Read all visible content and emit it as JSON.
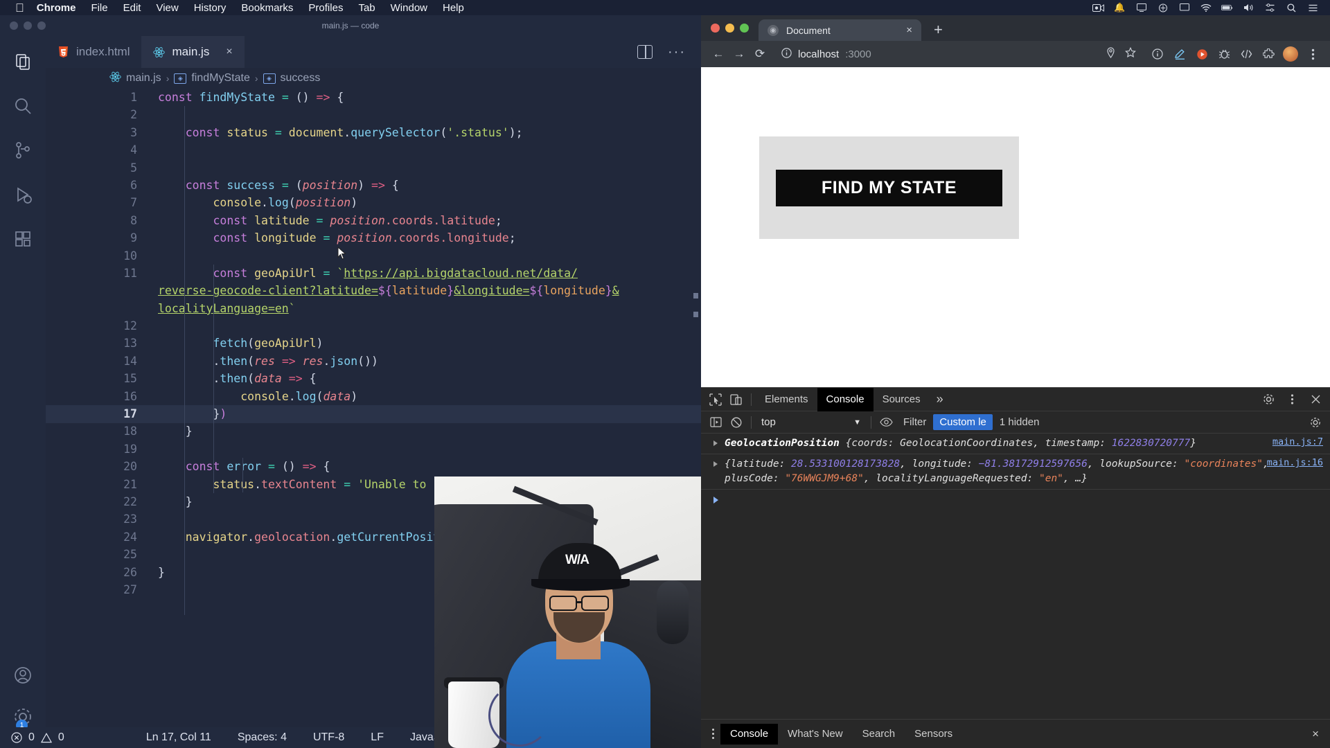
{
  "menubar": {
    "apple": "",
    "items": [
      {
        "label": "Chrome",
        "bold": true
      },
      {
        "label": "File"
      },
      {
        "label": "Edit"
      },
      {
        "label": "View"
      },
      {
        "label": "History"
      },
      {
        "label": "Bookmarks"
      },
      {
        "label": "Profiles"
      },
      {
        "label": "Tab"
      },
      {
        "label": "Window"
      },
      {
        "label": "Help"
      }
    ],
    "status_icons": [
      "video-camera-icon",
      "bell-icon",
      "screen-share-icon",
      "shield-icon",
      "display-icon",
      "wifi-icon",
      "battery-icon",
      "volume-icon",
      "control-center-icon",
      "search-icon",
      "list-icon"
    ]
  },
  "vscode": {
    "window_title": "main.js — code",
    "tabs": [
      {
        "label": "index.html",
        "icon": "html5-icon",
        "active": false
      },
      {
        "label": "main.js",
        "icon": "react-icon",
        "active": true
      }
    ],
    "tab_close_label": "×",
    "toolbar": {
      "split_editor": "split-editor-icon",
      "more_actions": "···"
    },
    "breadcrumb": {
      "file_icon": "react-icon",
      "parts": [
        "main.js",
        "findMyState",
        "success"
      ],
      "separator": "›"
    },
    "activity_items": [
      "explorer-icon",
      "search-icon",
      "source-control-icon",
      "run-debug-icon",
      "extensions-icon"
    ],
    "activity_bottom": [
      "accounts-icon",
      "settings-gear-icon"
    ],
    "settings_badge": "1",
    "statusbar": {
      "errors": "0",
      "warnings": "0",
      "position": "Ln 17, Col 11",
      "indent": "Spaces: 4",
      "encoding": "UTF-8",
      "eol": "LF",
      "language": "JavaScript React"
    },
    "current_line": 17,
    "code_lines": [
      {
        "n": "1",
        "html": "<span class='k'>const</span> <span class='fn'>findMyState</span> <span class='op'>=</span> <span class='par'>(</span><span class='par'>)</span> <span class='arrow'>=&gt;</span> <span class='par'>{</span>"
      },
      {
        "n": "2",
        "html": ""
      },
      {
        "n": "3",
        "html": "    <span class='k'>const</span> <span class='id'>status</span> <span class='op'>=</span> <span class='id'>document</span><span class='plain'>.</span><span class='fn'>querySelector</span><span class='par'>(</span><span class='str'>'.status'</span><span class='par'>)</span><span class='plain'>;</span>"
      },
      {
        "n": "4",
        "html": ""
      },
      {
        "n": "5",
        "html": ""
      },
      {
        "n": "6",
        "html": "    <span class='k'>const</span> <span class='fn'>success</span> <span class='op'>=</span> <span class='par'>(</span><span class='it'>position</span><span class='par'>)</span> <span class='arrow'>=&gt;</span> <span class='par'>{</span>"
      },
      {
        "n": "7",
        "html": "        <span class='id'>console</span><span class='plain'>.</span><span class='fn'>log</span><span class='par'>(</span><span class='it'>position</span><span class='par'>)</span>"
      },
      {
        "n": "8",
        "html": "        <span class='k'>const</span> <span class='id'>latitude</span> <span class='op'>=</span> <span class='it'>position</span><span class='prop'>.coords</span><span class='prop'>.latitude</span><span class='plain'>;</span>"
      },
      {
        "n": "9",
        "html": "        <span class='k'>const</span> <span class='id'>longitude</span> <span class='op'>=</span> <span class='it'>position</span><span class='prop'>.coords</span><span class='prop'>.longitude</span><span class='plain'>;</span>"
      },
      {
        "n": "10",
        "html": ""
      },
      {
        "n": "11",
        "html": "        <span class='k'>const</span> <span class='id'>geoApiUrl</span> <span class='op'>=</span> <span class='str'>`</span><span class='tpl'>https://api.bigdatacloud.net/data/</span>"
      },
      {
        "n": "",
        "html": "<span class='tpl'>reverse-geocode-client?latitude=</span><span class='dlr'>${</span><span class='ivar'>latitude</span><span class='dlr'>}</span><span class='tpl'>&amp;longitude=</span><span class='dlr'>${</span><span class='ivar'>longitude</span><span class='dlr'>}</span><span class='tpl'>&amp;</span>"
      },
      {
        "n": "",
        "html": "<span class='tpl'>localityLanguage=en</span><span class='str'>`</span>"
      },
      {
        "n": "12",
        "html": ""
      },
      {
        "n": "13",
        "html": "        <span class='fn'>fetch</span><span class='par'>(</span><span class='id'>geoApiUrl</span><span class='par'>)</span>"
      },
      {
        "n": "14",
        "html": "        <span class='plain'>.</span><span class='fn'>then</span><span class='par'>(</span><span class='it'>res</span> <span class='arrow'>=&gt;</span> <span class='it'>res</span><span class='plain'>.</span><span class='fn'>json</span><span class='par'>()</span><span class='par'>)</span>"
      },
      {
        "n": "15",
        "html": "        <span class='plain'>.</span><span class='fn'>then</span><span class='par'>(</span><span class='it'>data</span> <span class='arrow'>=&gt;</span> <span class='par'>{</span>"
      },
      {
        "n": "16",
        "html": "            <span class='id'>console</span><span class='plain'>.</span><span class='fn'>log</span><span class='par'>(</span><span class='it'>data</span><span class='par'>)</span>"
      },
      {
        "n": "17",
        "html": "        <span class='par'>}</span><span class='k'>)</span>"
      },
      {
        "n": "18",
        "html": "    <span class='par'>}</span>"
      },
      {
        "n": "19",
        "html": ""
      },
      {
        "n": "20",
        "html": "    <span class='k'>const</span> <span class='fn'>error</span> <span class='op'>=</span> <span class='par'>(</span><span class='par'>)</span> <span class='arrow'>=&gt;</span> <span class='par'>{</span>"
      },
      {
        "n": "21",
        "html": "        <span class='id'>status</span><span class='plain'>.</span><span class='prop'>textContent</span> <span class='op'>=</span> <span class='str'>'Unable to retri</span>"
      },
      {
        "n": "22",
        "html": "    <span class='par'>}</span>"
      },
      {
        "n": "23",
        "html": ""
      },
      {
        "n": "24",
        "html": "    <span class='id'>navigator</span><span class='plain'>.</span><span class='prop'>geolocation</span><span class='plain'>.</span><span class='fn'>getCurrentPosition</span><span class='par'>(</span>"
      },
      {
        "n": "25",
        "html": ""
      },
      {
        "n": "26",
        "html": "<span class='par'>}</span>"
      },
      {
        "n": "27",
        "html": ""
      }
    ]
  },
  "chrome": {
    "tab": {
      "title": "Document",
      "close": "×"
    },
    "new_tab": "+",
    "toolbar": {
      "back": "←",
      "forward": "→",
      "reload": "⟳",
      "info_icon": "info-circle-icon",
      "url_host": "localhost",
      "url_port": ":3000",
      "location_icon": "location-pin-icon",
      "bookmark_icon": "star-icon",
      "extensions": [
        "info-icon",
        "edit-pen-icon",
        "play-record-icon",
        "bug-icon",
        "devtools-icon",
        "puzzle-icon"
      ],
      "profile_icon": "avatar-icon",
      "menu_icon": "kebab-menu-icon"
    },
    "page": {
      "button_label": "FIND MY STATE"
    },
    "devtools": {
      "left_icons": [
        "inspect-element-icon",
        "device-toolbar-icon"
      ],
      "panels": [
        "Elements",
        "Console",
        "Sources"
      ],
      "active_panel": "Console",
      "more_panels": "»",
      "right_icons": [
        "settings-gear-icon",
        "kebab-menu-icon",
        "close-icon"
      ],
      "filterbar": {
        "execute_icon": "sidebar-toggle-icon",
        "clear_icon": "clear-console-icon",
        "context": "top",
        "context_caret": "▼",
        "eye_icon": "live-expression-icon",
        "filter_placeholder": "Filter",
        "level": "Custom le",
        "hidden": "1 hidden",
        "settings_icon": "settings-gear-icon"
      },
      "logs": [
        {
          "source": "main.js:7",
          "segments": [
            {
              "t": "GeolocationPosition ",
              "c": "c-objname"
            },
            {
              "t": "{coords: GeolocationCoordinates, timest",
              "c": "c-obj"
            },
            {
              "t": "amp: ",
              "c": "c-obj"
            },
            {
              "t": "1622830720777",
              "c": "c-num"
            },
            {
              "t": "}",
              "c": "c-obj"
            }
          ]
        },
        {
          "source": "main.js:16",
          "segments": [
            {
              "t": "{latitude: ",
              "c": "c-obj"
            },
            {
              "t": "28.533100128173828",
              "c": "c-num"
            },
            {
              "t": ", longitude: ",
              "c": "c-obj"
            },
            {
              "t": "−81.3817291259765",
              "c": "c-num"
            },
            {
              "t": "6",
              "c": "c-num"
            },
            {
              "t": ", lookupSource: ",
              "c": "c-obj"
            },
            {
              "t": "\"coordinates\"",
              "c": "c-str"
            },
            {
              "t": ", plusCode: ",
              "c": "c-obj"
            },
            {
              "t": "\"76WWGJM9+68\"",
              "c": "c-str"
            },
            {
              "t": ", lo",
              "c": "c-obj"
            },
            {
              "t": "calityLanguageRequested: ",
              "c": "c-obj"
            },
            {
              "t": "\"en\"",
              "c": "c-str"
            },
            {
              "t": ", …}",
              "c": "c-obj"
            }
          ]
        }
      ],
      "drawer_tabs": [
        "Console",
        "What's New",
        "Search",
        "Sensors"
      ],
      "drawer_active": "Console",
      "drawer_close": "×"
    }
  }
}
